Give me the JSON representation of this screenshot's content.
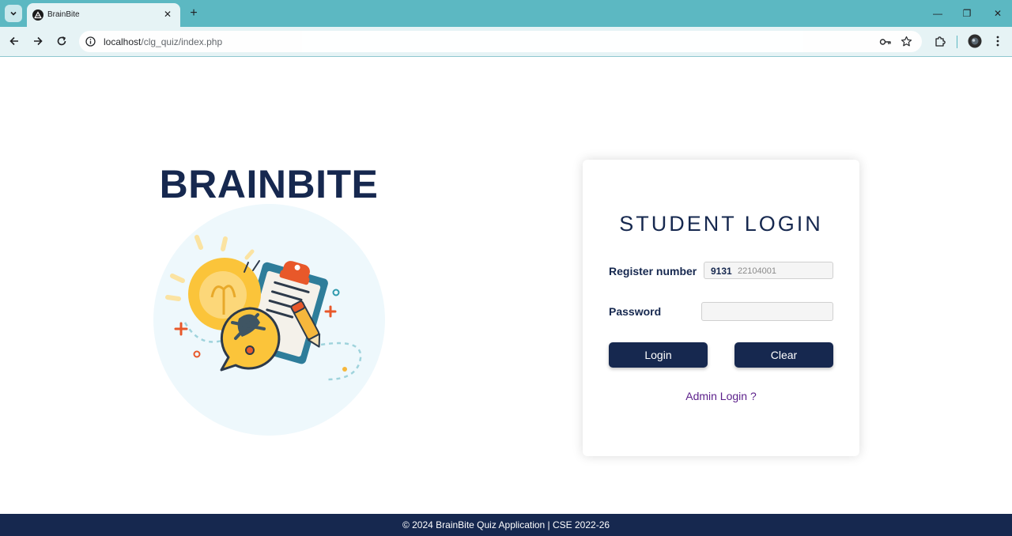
{
  "browser": {
    "tab_title": "BrainBite",
    "tab_close": "✕",
    "new_tab": "+",
    "url_host": "localhost",
    "url_path": "/clg_quiz/index.php",
    "window_minimize": "—",
    "window_restore": "❐",
    "window_close": "✕"
  },
  "page": {
    "brand": "BRAINBITE",
    "illustration_icon": "lightbulb-clipboard-illustration"
  },
  "login": {
    "title": "STUDENT LOGIN",
    "register_label": "Register number",
    "register_prefix": "9131",
    "register_placeholder": "22104001",
    "password_label": "Password",
    "password_value": "",
    "login_button": "Login",
    "clear_button": "Clear",
    "admin_link": "Admin Login ?"
  },
  "footer": {
    "text": "© 2024 BrainBite Quiz Application | CSE 2022-26"
  },
  "colors": {
    "chrome": "#5cb8c2",
    "navy": "#16284f",
    "admin_link": "#5b1f8a",
    "illustration_bg": "#eef8fc"
  }
}
